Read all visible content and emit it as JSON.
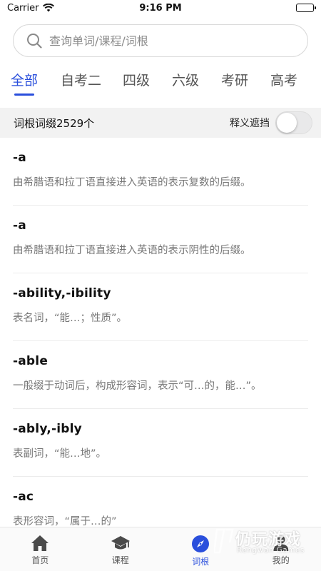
{
  "status_bar": {
    "carrier": "Carrier",
    "time": "9:16 PM"
  },
  "search": {
    "placeholder": "查询单词/课程/词根"
  },
  "tabs": [
    {
      "label": "全部"
    },
    {
      "label": "自考二"
    },
    {
      "label": "四级"
    },
    {
      "label": "六级"
    },
    {
      "label": "考研"
    },
    {
      "label": "高考"
    }
  ],
  "section": {
    "count_label": "词根词缀2529个",
    "toggle_label": "释义遮挡"
  },
  "entries": [
    {
      "term": "-a",
      "meaning": "由希腊语和拉丁语直接进入英语的表示复数的后缀。"
    },
    {
      "term": "-a",
      "meaning": "由希腊语和拉丁语直接进入英语的表示阴性的后缀。"
    },
    {
      "term": "-ability,-ibility",
      "meaning": "表名词，“能…；性质”。"
    },
    {
      "term": "-able",
      "meaning": "一般缀于动词后，构成形容词，表示“可…的，能…”。"
    },
    {
      "term": "-ably,-ibly",
      "meaning": "表副词，“能…地”。"
    },
    {
      "term": "-ac",
      "meaning": "表形容词，“属于…的”"
    }
  ],
  "bottom_nav": [
    {
      "label": "首页",
      "icon": "home-icon"
    },
    {
      "label": "课程",
      "icon": "graduation-cap-icon"
    },
    {
      "label": "词根",
      "icon": "compass-icon"
    },
    {
      "label": "我的",
      "icon": "user-icon"
    }
  ],
  "watermark": {
    "text": "仍玩游戏",
    "sub": "Rengwan Games"
  },
  "colors": {
    "accent": "#2a4fdc",
    "section_bg": "#f2f2f2",
    "meaning_text": "#777777"
  }
}
